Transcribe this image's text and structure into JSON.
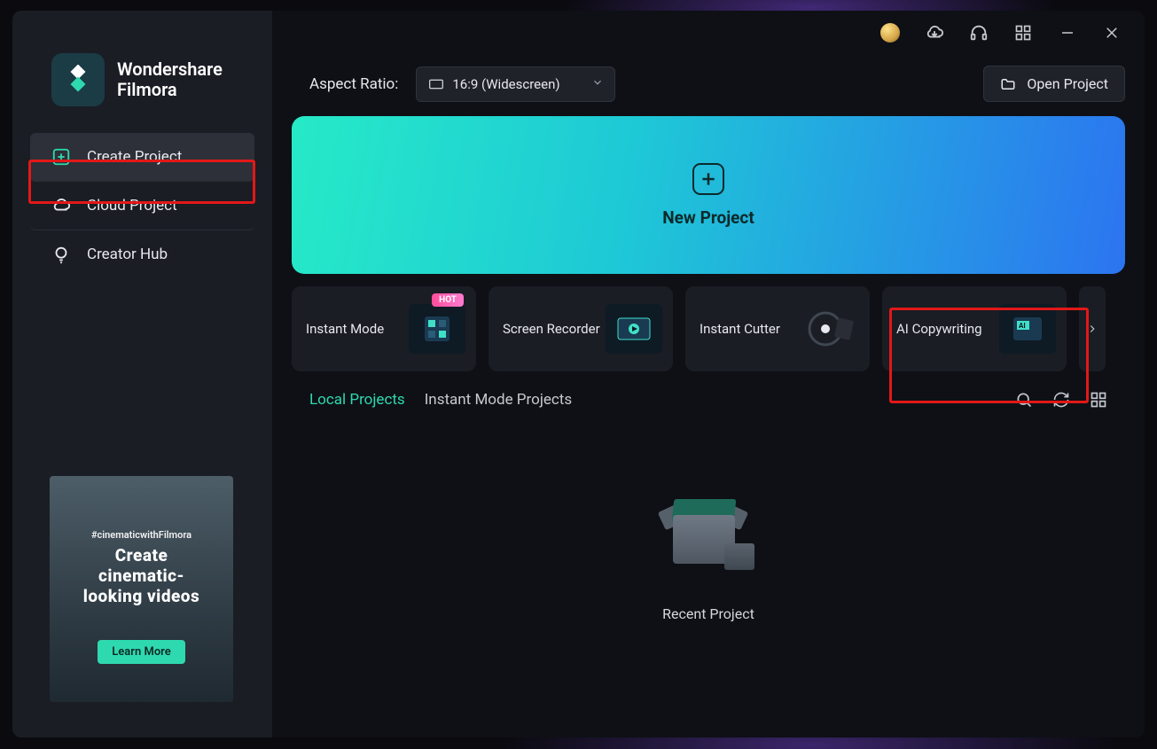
{
  "app": {
    "brand_line1": "Wondershare",
    "brand_line2": "Filmora"
  },
  "sidebar": {
    "items": [
      {
        "label": "Create Project",
        "icon": "plus-square-icon",
        "active": true
      },
      {
        "label": "Cloud Project",
        "icon": "cloud-icon",
        "active": false
      },
      {
        "label": "Creator Hub",
        "icon": "bulb-icon",
        "active": false
      }
    ],
    "promo": {
      "hashtag": "#cinematicwithFilmora",
      "title_line1": "Create",
      "title_line2": "cinematic-",
      "title_line3": "looking videos",
      "cta": "Learn More"
    }
  },
  "toolbar": {
    "aspect_label": "Aspect Ratio:",
    "aspect_value": "16:9 (Widescreen)",
    "open_project": "Open Project"
  },
  "new_project": {
    "label": "New Project"
  },
  "features": [
    {
      "label": "Instant Mode",
      "badge": "HOT"
    },
    {
      "label": "Screen Recorder",
      "badge": null
    },
    {
      "label": "Instant Cutter",
      "badge": null
    },
    {
      "label": "AI Copywriting",
      "badge": null
    }
  ],
  "tabs": {
    "items": [
      {
        "label": "Local Projects",
        "active": true
      },
      {
        "label": "Instant Mode Projects",
        "active": false
      }
    ]
  },
  "recent": {
    "label": "Recent Project"
  },
  "highlights": {
    "sidebar_create": true,
    "feature_ai_copywriting": true
  },
  "colors": {
    "accent": "#2fd9b0",
    "highlight": "#e21818"
  }
}
